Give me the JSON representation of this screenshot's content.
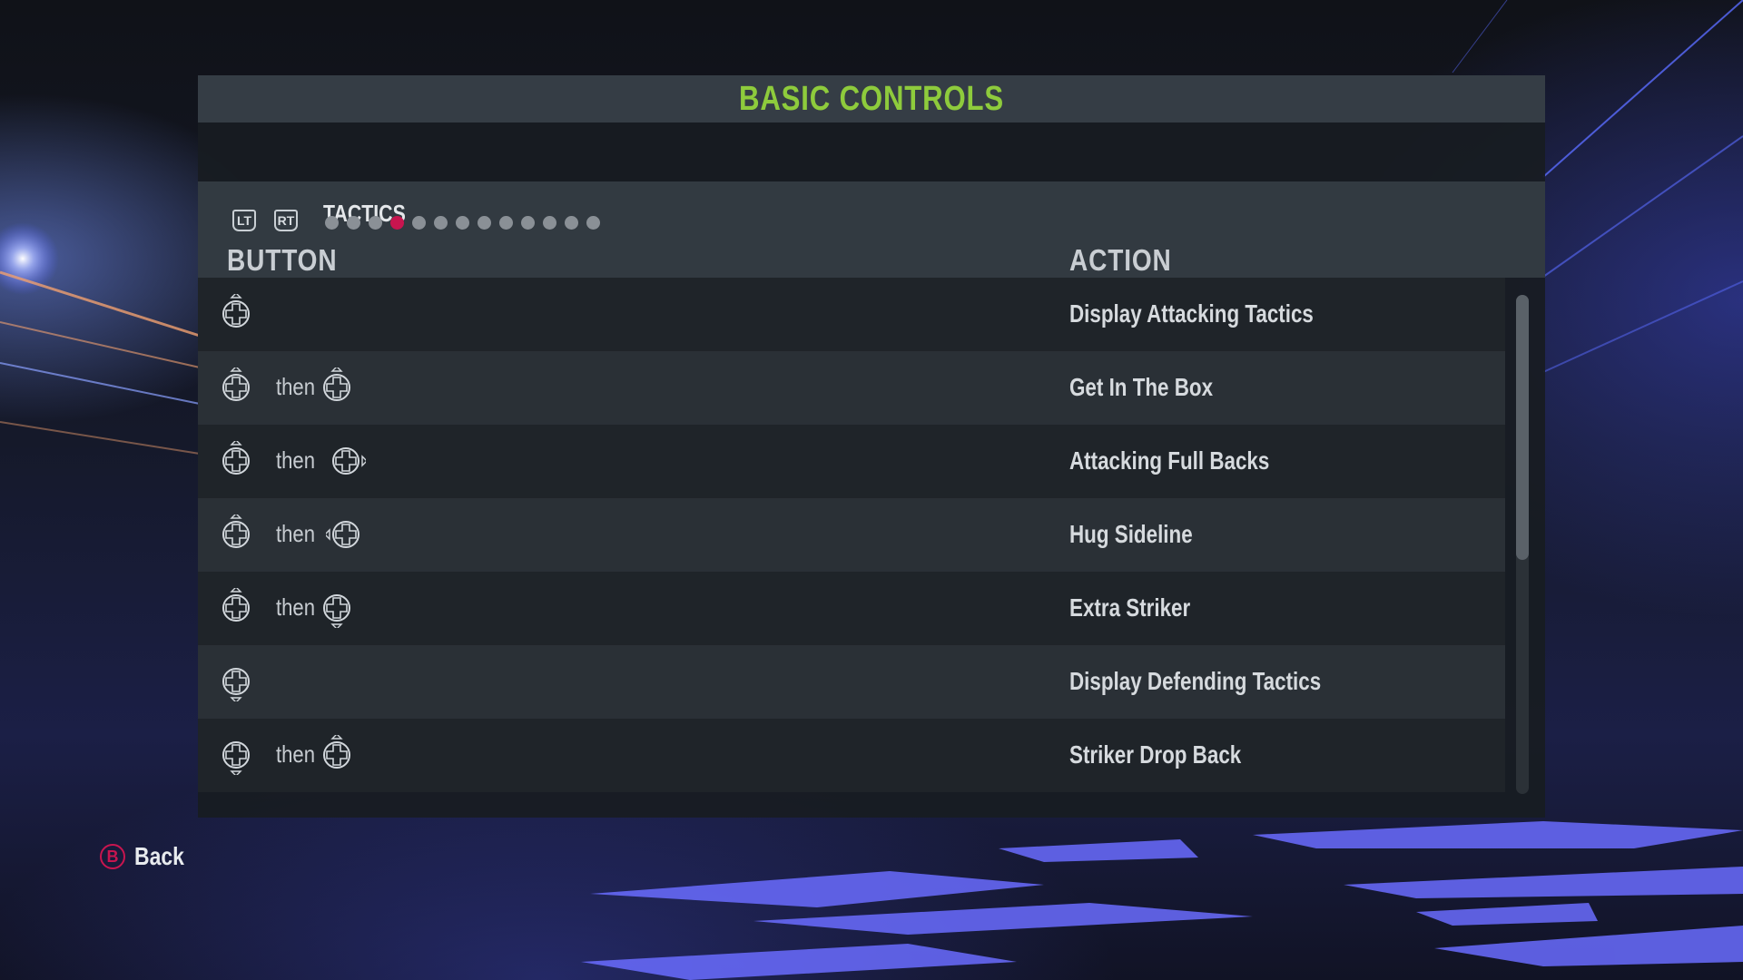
{
  "colors": {
    "accent_green": "#8ecb3c",
    "accent_red": "#c8154f"
  },
  "title": "BASIC CONTROLS",
  "section": {
    "left_trigger": "LT",
    "right_trigger": "RT",
    "label": "TACTICS",
    "page_count": 13,
    "active_page": 4
  },
  "columns": {
    "button": "BUTTON",
    "action": "ACTION"
  },
  "rows": [
    {
      "first": "dpad-up-icon",
      "then": "",
      "second": "",
      "action": "Display Attacking Tactics"
    },
    {
      "first": "dpad-up-icon",
      "then": "then",
      "second": "dpad-up-icon",
      "action": "Get In The Box"
    },
    {
      "first": "dpad-up-icon",
      "then": "then",
      "second": "dpad-right-icon",
      "action": "Attacking Full Backs"
    },
    {
      "first": "dpad-up-icon",
      "then": "then",
      "second": "dpad-left-icon",
      "action": "Hug Sideline"
    },
    {
      "first": "dpad-up-icon",
      "then": "then",
      "second": "dpad-down-icon",
      "action": "Extra Striker"
    },
    {
      "first": "dpad-down-icon",
      "then": "",
      "second": "",
      "action": "Display Defending Tactics"
    },
    {
      "first": "dpad-down-icon",
      "then": "then",
      "second": "dpad-up-icon",
      "action": "Striker Drop Back"
    }
  ],
  "footer": {
    "back_icon": "B",
    "back_label": "Back"
  }
}
